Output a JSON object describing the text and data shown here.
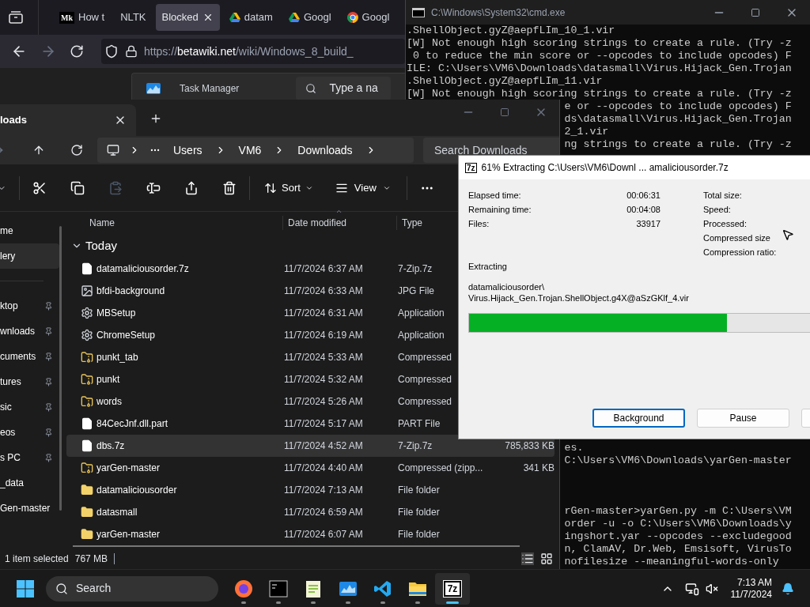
{
  "browser": {
    "tabs": [
      {
        "kind": "monogram",
        "icon_text": "Mk",
        "label": "How t",
        "selected": false
      },
      {
        "kind": "plain",
        "label": "NLTK",
        "selected": false
      },
      {
        "kind": "plain",
        "label": "Blocked",
        "selected": true
      },
      {
        "kind": "drive",
        "label": "datam",
        "selected": false
      },
      {
        "kind": "drive",
        "label": "Googl",
        "selected": false
      },
      {
        "kind": "chrome",
        "label": "Googl",
        "selected": false
      }
    ],
    "url_scheme": "https://",
    "url_domain": "betawiki.net",
    "url_path": "/wiki/Windows_8_build_"
  },
  "task_manager": {
    "title": "Task Manager",
    "search_placeholder": "Type a na"
  },
  "cmd": {
    "title": "C:\\Windows\\System32\\cmd.exe",
    "lines_top": [
      {
        "kind": "full",
        "text": ".ShellObject.gyZ@aepfLIm_10_1.vir"
      },
      {
        "kind": "full",
        "text": "[W] Not enough high scoring strings to create a rule. (Try -z"
      },
      {
        "kind": "full",
        "text": " 0 to reduce the min score or --opcodes to include opcodes) F"
      },
      {
        "kind": "full",
        "text": "ILE: C:\\Users\\VM6\\Downloads\\datasmall\\Virus.Hijack_Gen.Trojan"
      },
      {
        "kind": "full",
        "text": ".ShellObject.gyZ@aepfLIm_11.vir"
      },
      {
        "kind": "full",
        "text": "[W] Not enough high scoring strings to create a rule. (Try -z"
      },
      {
        "kind": "clipped",
        "text": "e or --opcodes to include opcodes) F"
      },
      {
        "kind": "clipped",
        "text": "ds\\datasmall\\Virus.Hijack_Gen.Trojan"
      },
      {
        "kind": "clipped",
        "text": "2_1.vir"
      },
      {
        "kind": "clipped",
        "text": "ng strings to create a rule. (Try -z"
      }
    ],
    "lines_bottom": [
      {
        "kind": "clipped",
        "text": "es."
      },
      {
        "kind": "clipped",
        "text": "C:\\Users\\VM6\\Downloads\\yarGen-master"
      }
    ],
    "lines_end": [
      {
        "kind": "clipped",
        "text": "rGen-master>yarGen.py -m C:\\Users\\VM"
      },
      {
        "kind": "clipped",
        "text": "order -u -o C:\\Users\\VM6\\Downloads\\y"
      },
      {
        "kind": "clipped",
        "text": "ingshort.yar --opcodes --excludegood"
      },
      {
        "kind": "clipped",
        "text": "n, ClamAV, Dr.Web, Emsisoft, VirusTo"
      },
      {
        "kind": "clipped",
        "text": "nofilesize --meaningful-words-only"
      }
    ]
  },
  "explorer": {
    "tab_label": "loads",
    "breadcrumb": [
      "Users",
      "VM6",
      "Downloads"
    ],
    "search_placeholder": "Search Downloads",
    "toolbar": {
      "sort": "Sort",
      "view": "View"
    },
    "sidebar": [
      {
        "label": "me",
        "pinned": false,
        "selected": false
      },
      {
        "label": "lery",
        "pinned": false,
        "selected": true
      },
      {
        "label": "ktop",
        "pinned": true,
        "selected": false
      },
      {
        "label": "wnloads",
        "pinned": true,
        "selected": false
      },
      {
        "label": "cuments",
        "pinned": true,
        "selected": false
      },
      {
        "label": "tures",
        "pinned": true,
        "selected": false
      },
      {
        "label": "sic",
        "pinned": true,
        "selected": false
      },
      {
        "label": "eos",
        "pinned": true,
        "selected": false
      },
      {
        "label": "s PC",
        "pinned": true,
        "selected": false
      },
      {
        "label": "_data",
        "pinned": false,
        "selected": false
      },
      {
        "label": "Gen-master",
        "pinned": false,
        "selected": false
      }
    ],
    "columns": [
      "Name",
      "Date modified",
      "Type"
    ],
    "group": "Today",
    "rows": [
      {
        "kind": "file",
        "name": "datamaliciousorder.7z",
        "date": "11/7/2024 6:37 AM",
        "type": "7-Zip.7z",
        "selected": false
      },
      {
        "kind": "image",
        "name": "bfdi-background",
        "date": "11/7/2024 6:33 AM",
        "type": "JPG File",
        "selected": false
      },
      {
        "kind": "setup",
        "name": "MBSetup",
        "date": "11/7/2024 6:31 AM",
        "type": "Application",
        "selected": false
      },
      {
        "kind": "setup",
        "name": "ChromeSetup",
        "date": "11/7/2024 6:19 AM",
        "type": "Application",
        "selected": false
      },
      {
        "kind": "zip",
        "name": "punkt_tab",
        "date": "11/7/2024 5:33 AM",
        "type": "Compressed",
        "selected": false
      },
      {
        "kind": "zip",
        "name": "punkt",
        "date": "11/7/2024 5:32 AM",
        "type": "Compressed",
        "selected": false
      },
      {
        "kind": "zip",
        "name": "words",
        "date": "11/7/2024 5:26 AM",
        "type": "Compressed",
        "selected": false
      },
      {
        "kind": "file",
        "name": "84CecJnf.dll.part",
        "date": "11/7/2024 5:17 AM",
        "type": "PART File",
        "selected": false
      },
      {
        "kind": "file",
        "name": "dbs.7z",
        "date": "11/7/2024 4:52 AM",
        "type": "7-Zip.7z",
        "size": "785,833 KB",
        "selected": true
      },
      {
        "kind": "zip",
        "name": "yarGen-master",
        "date": "11/7/2024 4:40 AM",
        "type": "Compressed (zipp...",
        "size": "341 KB",
        "selected": false
      },
      {
        "kind": "folder",
        "name": "datamaliciousorder",
        "date": "11/7/2024 7:13 AM",
        "type": "File folder",
        "selected": false
      },
      {
        "kind": "folder",
        "name": "datasmall",
        "date": "11/7/2024 6:59 AM",
        "type": "File folder",
        "selected": false
      },
      {
        "kind": "folder",
        "name": "yarGen-master",
        "date": "11/7/2024 6:07 AM",
        "type": "File folder",
        "selected": false
      }
    ],
    "status": "1 item selected",
    "status_size": "767 MB"
  },
  "extract_dialog": {
    "icon_text": "7z",
    "title": "61% Extracting C:\\Users\\VM6\\Downl ... amaliciousorder.7z",
    "stats_left": [
      {
        "label": "Elapsed time:",
        "value": "00:06:31"
      },
      {
        "label": "Remaining time:",
        "value": "00:04:08"
      },
      {
        "label": "Files:",
        "value": "33917"
      }
    ],
    "stats_right": [
      "Total size:",
      "Speed:",
      "Processed:",
      "Compressed size",
      "Compression ratio:"
    ],
    "extracting_label": "Extracting",
    "current_path": "datamaliciousorder\\",
    "current_file": "Virus.Hijack_Gen.Trojan.ShellObject.g4X@aSzGKlf_4.vir",
    "progress": {
      "level": 0.61
    },
    "buttons": [
      {
        "label": "Background",
        "focused": true
      },
      {
        "label": "Pause",
        "focused": false
      }
    ]
  },
  "taskbar": {
    "search": "Search",
    "apps": [
      {
        "kind": "firefox",
        "active": false
      },
      {
        "kind": "terminal",
        "active": false
      },
      {
        "kind": "notepad",
        "active": false
      },
      {
        "kind": "taskmgr",
        "active": false
      },
      {
        "kind": "vscode",
        "active": false
      },
      {
        "kind": "explorer",
        "active": false
      },
      {
        "kind": "sevenzip",
        "icon_text": "7z",
        "active": true
      }
    ],
    "time": "7:13 AM",
    "date": "11/7/2024"
  }
}
